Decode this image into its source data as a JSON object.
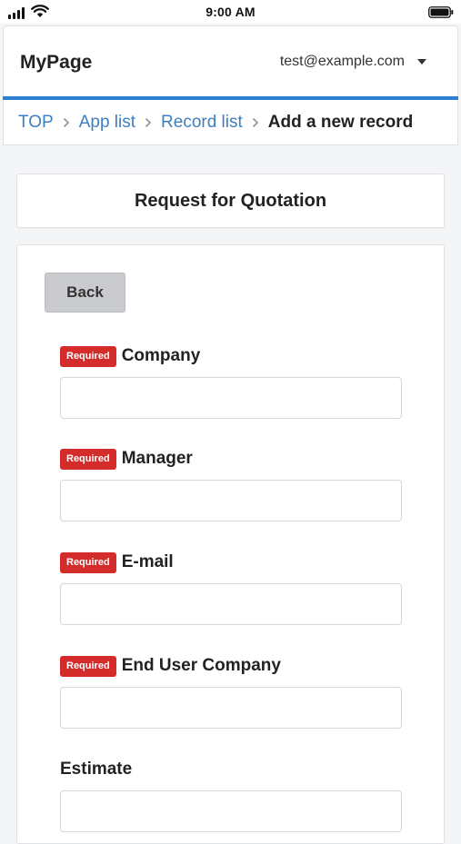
{
  "status_bar": {
    "time": "9:00 AM",
    "signal_icon": "cellular-signal-icon",
    "wifi_icon": "wifi-icon",
    "battery_icon": "battery-icon"
  },
  "header": {
    "app_title": "MyPage",
    "user_email": "test@example.com",
    "accent_color": "#2e7fcf"
  },
  "breadcrumb": {
    "items": [
      "TOP",
      "App list",
      "Record list"
    ],
    "current": "Add a new record",
    "separator_icon": "chevron-right-icon",
    "link_color": "#3d7fc0"
  },
  "form": {
    "title": "Request for Quotation",
    "back_label": "Back",
    "required_badge": "Required",
    "required_color": "#d42b2b",
    "fields": [
      {
        "label": "Company",
        "required": true,
        "value": ""
      },
      {
        "label": "Manager",
        "required": true,
        "value": ""
      },
      {
        "label": "E-mail",
        "required": true,
        "value": ""
      },
      {
        "label": "End User Company",
        "required": true,
        "value": ""
      },
      {
        "label": "Estimate",
        "required": false,
        "value": ""
      }
    ]
  }
}
